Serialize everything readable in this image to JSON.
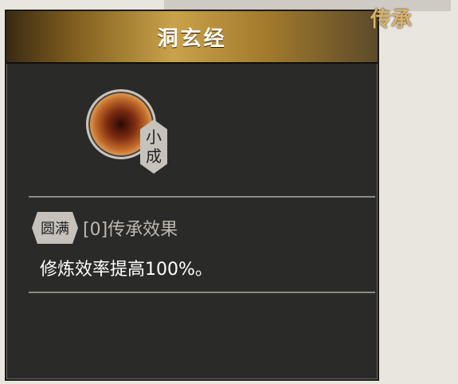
{
  "tooltip": {
    "title": "洞玄经",
    "inherit_label": "传承",
    "stage_label": "小成",
    "tier_tag": "圆满",
    "effect_title": "[0]传承效果",
    "effect_description": "修炼效率提高100%。"
  },
  "icons": {
    "skill": "scripture-skill-icon"
  }
}
